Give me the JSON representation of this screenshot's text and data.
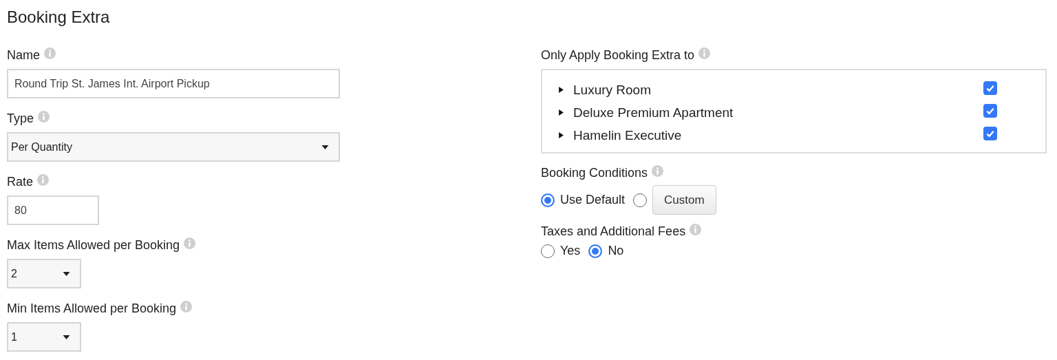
{
  "title": "Booking Extra",
  "left_fields": [
    {
      "kind": "text",
      "label": "Name",
      "value": "Round Trip St. James Int. Airport Pickup"
    },
    {
      "kind": "select",
      "label": "Type",
      "value": "Per Quantity"
    },
    {
      "kind": "text",
      "label": "Rate",
      "value": "80"
    },
    {
      "kind": "select",
      "label": "Max Items Allowed per Booking",
      "value": "2"
    },
    {
      "kind": "select",
      "label": "Min Items Allowed per Booking",
      "value": "1"
    }
  ],
  "apply_to": {
    "label": "Only Apply Booking Extra to",
    "items": [
      {
        "name": "Luxury Room",
        "expanded": false,
        "checked": true
      },
      {
        "name": "Deluxe Premium Apartment",
        "expanded": false,
        "checked": true
      },
      {
        "name": "Hamelin Executive",
        "expanded": false,
        "checked": true
      }
    ]
  },
  "radio_groups": [
    {
      "label": "Booking Conditions",
      "options": [
        {
          "kind": "label",
          "text": "Use Default",
          "selected": true
        },
        {
          "kind": "button",
          "text": "Custom",
          "selected": false
        }
      ]
    },
    {
      "label": "Taxes and Additional Fees",
      "options": [
        {
          "kind": "label",
          "text": "Yes",
          "selected": false
        },
        {
          "kind": "label",
          "text": "No",
          "selected": true
        }
      ]
    }
  ]
}
